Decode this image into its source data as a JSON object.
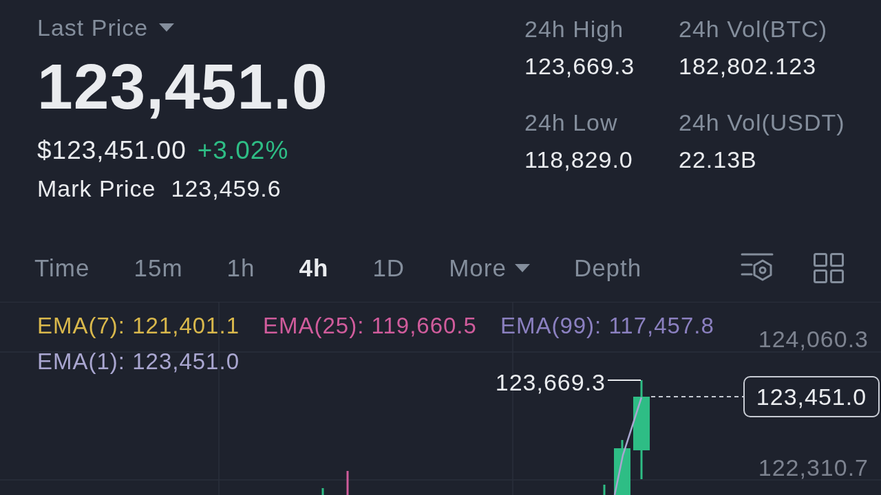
{
  "ticker": {
    "price_type": {
      "label": "Last Price"
    },
    "last_price": "123,451.0",
    "usd_price": "$123,451.00",
    "change": {
      "text": "+3.02%",
      "positive": true
    },
    "mark_price": {
      "label": "Mark Price",
      "value": "123,459.6"
    }
  },
  "stat_columns": [
    {
      "items": [
        {
          "label": "24h High",
          "value": "123,669.3"
        },
        {
          "label": "24h Low",
          "value": "118,829.0"
        }
      ]
    },
    {
      "items": [
        {
          "label": "24h Vol(BTC)",
          "value": "182,802.123"
        },
        {
          "label": "24h Vol(USDT)",
          "value": "22.13B"
        }
      ]
    }
  ],
  "interval_tabs": [
    {
      "label": "Time",
      "kind": "tab",
      "selected": false
    },
    {
      "label": "15m",
      "kind": "tab",
      "selected": false
    },
    {
      "label": "1h",
      "kind": "tab",
      "selected": false
    },
    {
      "label": "4h",
      "kind": "tab",
      "selected": true
    },
    {
      "label": "1D",
      "kind": "tab",
      "selected": false
    },
    {
      "label": "More",
      "kind": "dropdown",
      "selected": false
    },
    {
      "label": "Depth",
      "kind": "tab",
      "selected": false
    }
  ],
  "chart": {
    "legend_rows": [
      {
        "items": [
          {
            "label": "EMA(7): 121,401.1",
            "color": "#d9b84c"
          },
          {
            "label": "EMA(25): 119,660.5",
            "color": "#d05c9c"
          },
          {
            "label": "EMA(99): 117,457.8",
            "color": "#8b80c0"
          }
        ]
      },
      {
        "items": [
          {
            "label": "EMA(1): 123,451.0",
            "color": "#a9a6d0"
          }
        ]
      }
    ],
    "price_axis": [
      "124,060.3",
      "122,310.7"
    ],
    "high_marker": "123,669.3",
    "current_price": "123,451.0"
  }
}
